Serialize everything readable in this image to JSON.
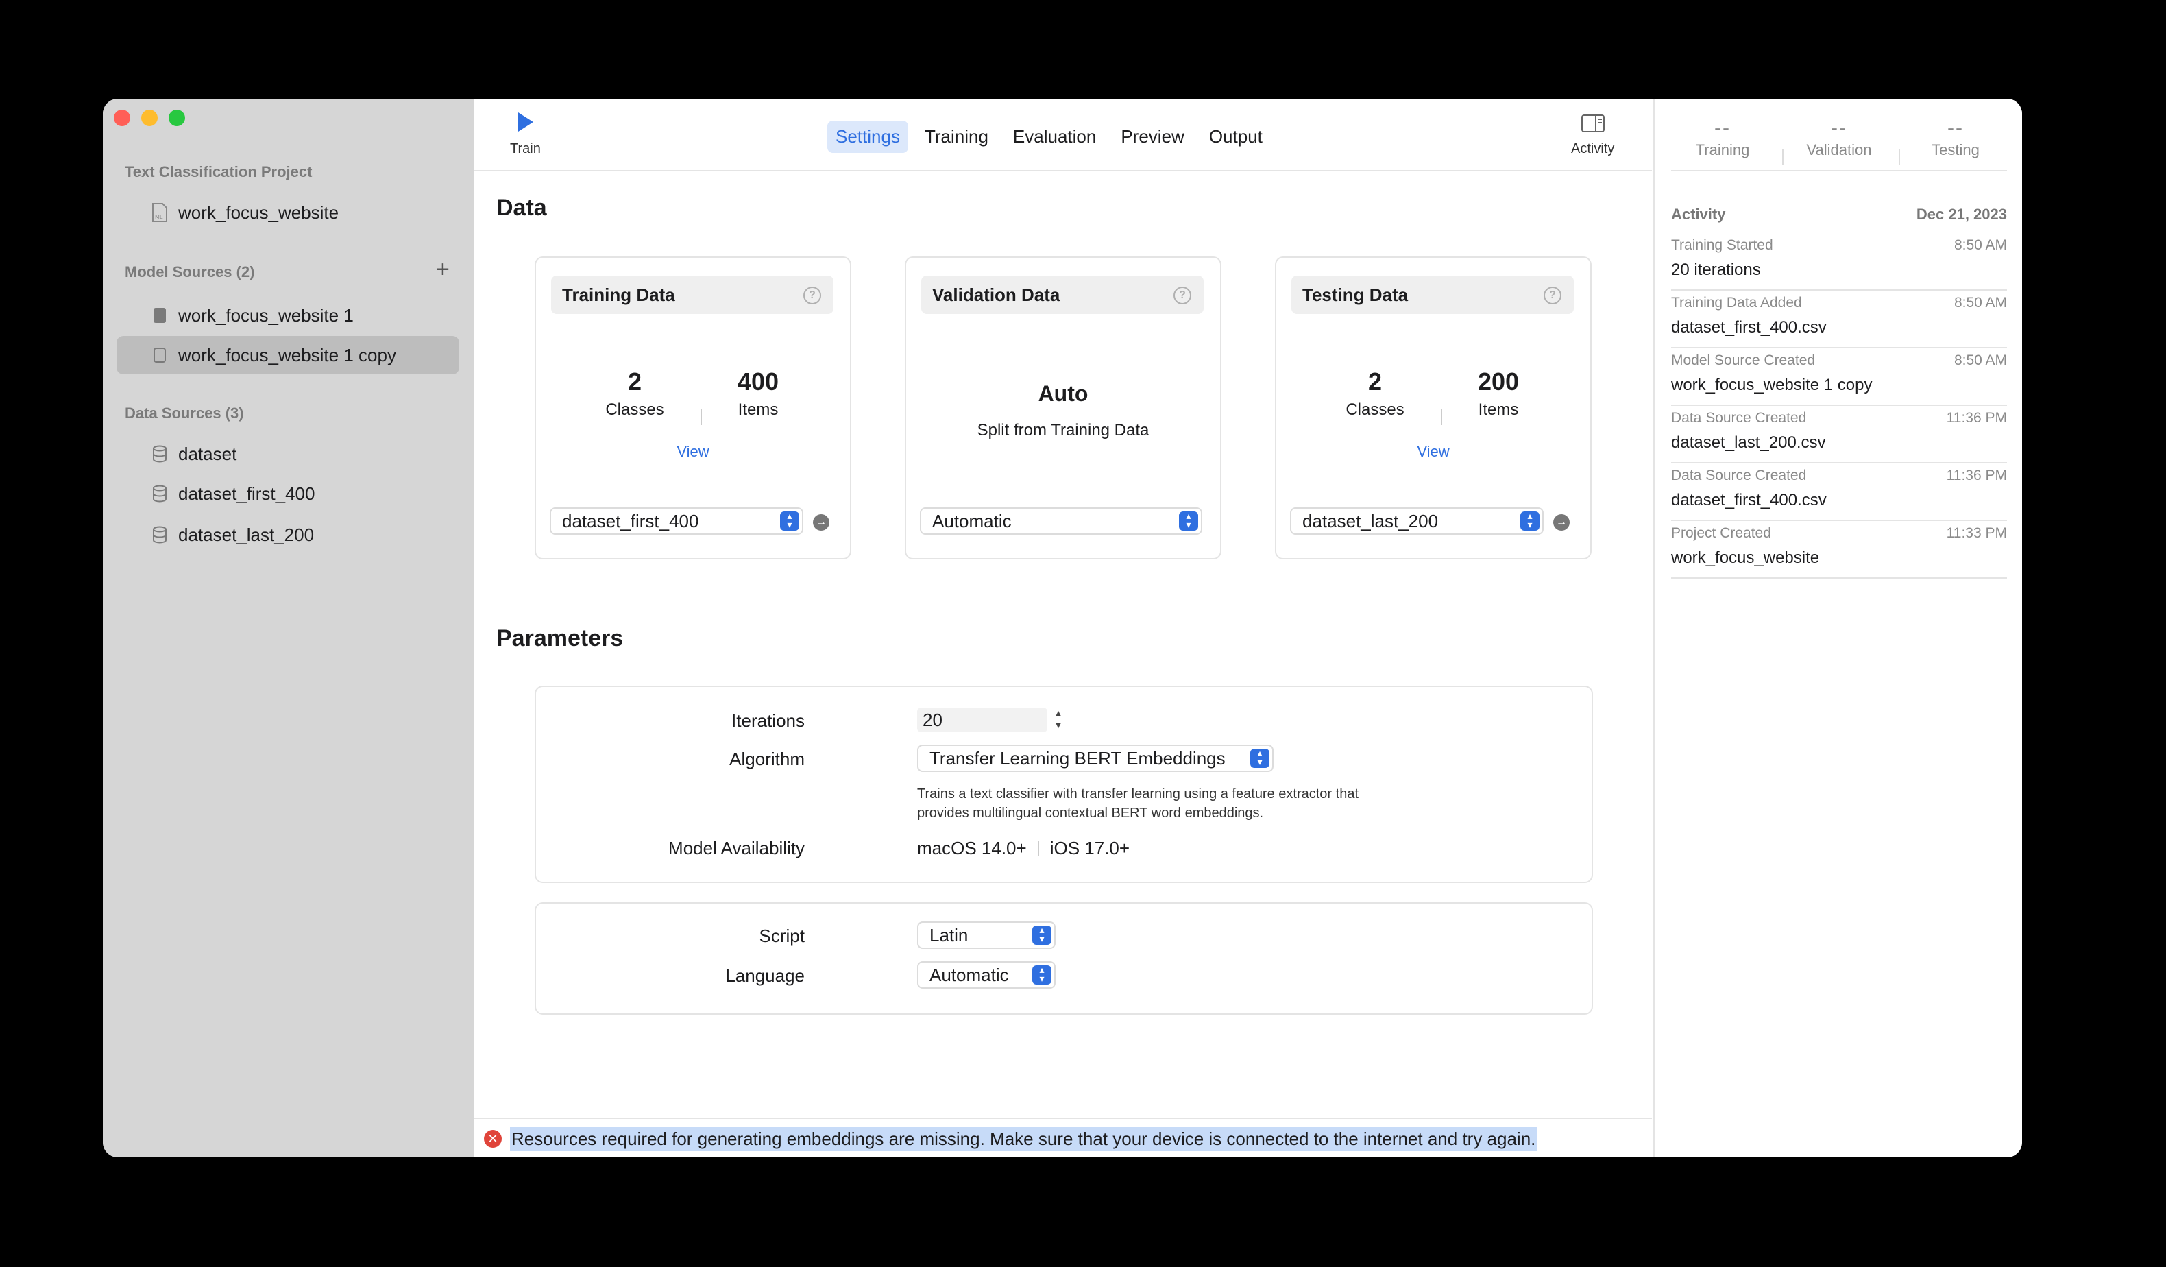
{
  "sidebar": {
    "project_header": "Text Classification Project",
    "project_item": "work_focus_website",
    "model_sources_header": "Model Sources (2)",
    "model_sources": [
      "work_focus_website 1",
      "work_focus_website 1 copy"
    ],
    "data_sources_header": "Data Sources (3)",
    "data_sources": [
      "dataset",
      "dataset_first_400",
      "dataset_last_200"
    ],
    "add_symbol": "+"
  },
  "toolbar": {
    "train_label": "Train",
    "tabs": [
      "Settings",
      "Training",
      "Evaluation",
      "Preview",
      "Output"
    ],
    "activity_label": "Activity"
  },
  "data_section": {
    "title": "Data",
    "training": {
      "title": "Training Data",
      "classes_count": "2",
      "classes_label": "Classes",
      "items_count": "400",
      "items_label": "Items",
      "view_label": "View",
      "selected": "dataset_first_400"
    },
    "validation": {
      "title": "Validation Data",
      "value": "Auto",
      "subtitle": "Split from Training Data",
      "selected": "Automatic"
    },
    "testing": {
      "title": "Testing Data",
      "classes_count": "2",
      "classes_label": "Classes",
      "items_count": "200",
      "items_label": "Items",
      "view_label": "View",
      "selected": "dataset_last_200"
    },
    "help_symbol": "?"
  },
  "parameters": {
    "title": "Parameters",
    "iterations_label": "Iterations",
    "iterations_value": "20",
    "algorithm_label": "Algorithm",
    "algorithm_value": "Transfer Learning BERT Embeddings",
    "algorithm_desc_1": "Trains a text classifier with transfer learning using a feature extractor that",
    "algorithm_desc_2": "provides multilingual contextual BERT word embeddings.",
    "availability_label": "Model Availability",
    "availability_macos": "macOS 14.0+",
    "availability_ios": "iOS 17.0+",
    "script_label": "Script",
    "script_value": "Latin",
    "language_label": "Language",
    "language_value": "Automatic"
  },
  "error": {
    "message": "Resources required for generating embeddings are missing. Make sure that your device is connected to the internet and try again."
  },
  "inspector": {
    "metrics": [
      {
        "value": "--",
        "label": "Training"
      },
      {
        "value": "--",
        "label": "Validation"
      },
      {
        "value": "--",
        "label": "Testing"
      }
    ],
    "activity_header": "Activity",
    "activity_date": "Dec 21, 2023",
    "entries": [
      {
        "title": "Training Started",
        "time": "8:50 AM",
        "detail": "20 iterations"
      },
      {
        "title": "Training Data Added",
        "time": "8:50 AM",
        "detail": "dataset_first_400.csv"
      },
      {
        "title": "Model Source Created",
        "time": "8:50 AM",
        "detail": "work_focus_website 1 copy"
      },
      {
        "title": "Data Source Created",
        "time": "11:36 PM",
        "detail": "dataset_last_200.csv"
      },
      {
        "title": "Data Source Created",
        "time": "11:36 PM",
        "detail": "dataset_first_400.csv"
      },
      {
        "title": "Project Created",
        "time": "11:33 PM",
        "detail": "work_focus_website"
      }
    ]
  },
  "colors": {
    "accent": "#2f6fe0",
    "close": "#ff5f57",
    "minimize": "#febc2e",
    "zoom": "#28c840",
    "error": "#e0443a",
    "selection": "#c7dbf8"
  }
}
